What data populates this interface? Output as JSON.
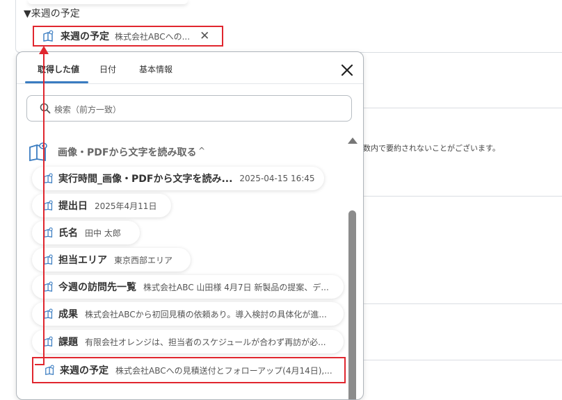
{
  "background": {
    "section_label": "▼来週の予定",
    "chip": {
      "title": "来週の予定",
      "value": "株式会社ABCへの...",
      "close": "✕"
    },
    "note": "数内で要約されないことがございます。"
  },
  "panel": {
    "tabs": [
      {
        "label": "取得した値",
        "active": true
      },
      {
        "label": "日付",
        "active": false
      },
      {
        "label": "基本情報",
        "active": false
      }
    ],
    "search_placeholder": "検索（前方一致）",
    "group": {
      "title": "画像・PDFから文字を読み取る",
      "chevron": "^"
    },
    "items": [
      {
        "label": "実行時間_画像・PDFから文字を読み...",
        "value": "2025-04-15 16:45"
      },
      {
        "label": "提出日",
        "value": "2025年4月11日"
      },
      {
        "label": "氏名",
        "value": "田中 太郎"
      },
      {
        "label": "担当エリア",
        "value": "東京西部エリア"
      },
      {
        "label": "今週の訪問先一覧",
        "value": "株式会社ABC 山田様 4月7日 新製品の提案、デ..."
      },
      {
        "label": "成果",
        "value": "株式会社ABCから初回見積の依頼あり。導入検討の具体化が進..."
      },
      {
        "label": "課題",
        "value": "有限会社オレンジは、担当者のスケジュールが合わず再訪が必..."
      },
      {
        "label": "来週の予定",
        "value": "株式会社ABCへの見積送付とフォローアップ(4月14日),..."
      }
    ]
  },
  "colors": {
    "accent": "#3a7cc1",
    "highlight": "#e0262e",
    "border": "#aeb4ba"
  }
}
